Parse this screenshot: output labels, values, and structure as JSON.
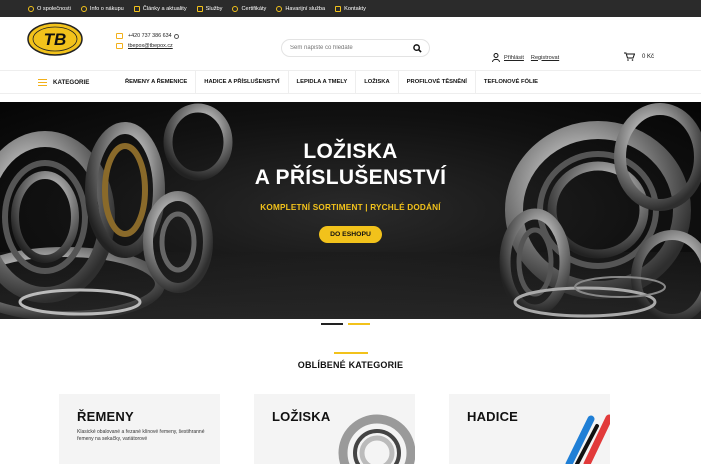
{
  "topbar": {
    "items": [
      {
        "label": "O společnosti",
        "icon": "gear-icon"
      },
      {
        "label": "Info o nákupu",
        "icon": "info-icon"
      },
      {
        "label": "Články a aktuality",
        "icon": "news-icon"
      },
      {
        "label": "Služby",
        "icon": "check-icon"
      },
      {
        "label": "Certifikáty",
        "icon": "certificate-icon"
      },
      {
        "label": "Havarijní služba",
        "icon": "emergency-icon"
      },
      {
        "label": "Kontakty",
        "icon": "phone-icon"
      }
    ]
  },
  "header": {
    "logo_text": "TB",
    "phone": "+420 737 386 634",
    "email": "tbepox@tbepox.cz",
    "search_placeholder": "Sem napište co hledáte",
    "login_label": "Přihlásit",
    "register_label": "Registrovat",
    "cart_total": "0 Kč"
  },
  "nav": {
    "category_label": "KATEGORIE",
    "links": [
      "ŘEMENY A ŘEMENICE",
      "HADICE A PŘÍSLUŠENSTVÍ",
      "LEPIDLA A TMELY",
      "LOŽISKA",
      "PROFILOVÉ TĚSNĚNÍ",
      "TEFLONOVÉ FÓLIE"
    ]
  },
  "hero": {
    "title_line1": "LOŽISKA",
    "title_line2": "A PŘÍSLUŠENSTVÍ",
    "subtitle": "KOMPLETNÍ SORTIMENT | RYCHLÉ DODÁNÍ",
    "button_label": "DO ESHOPU",
    "accent": "#f2c21b"
  },
  "favorites": {
    "heading": "OBLÍBENÉ KATEGORIE",
    "cards": [
      {
        "title": "ŘEMENY",
        "text": "Klasické obalované a řezané klínové řemeny, šestihranné řemeny na sekačky, variátorové"
      },
      {
        "title": "LOŽISKA",
        "text": ""
      },
      {
        "title": "HADICE",
        "text": ""
      }
    ]
  }
}
